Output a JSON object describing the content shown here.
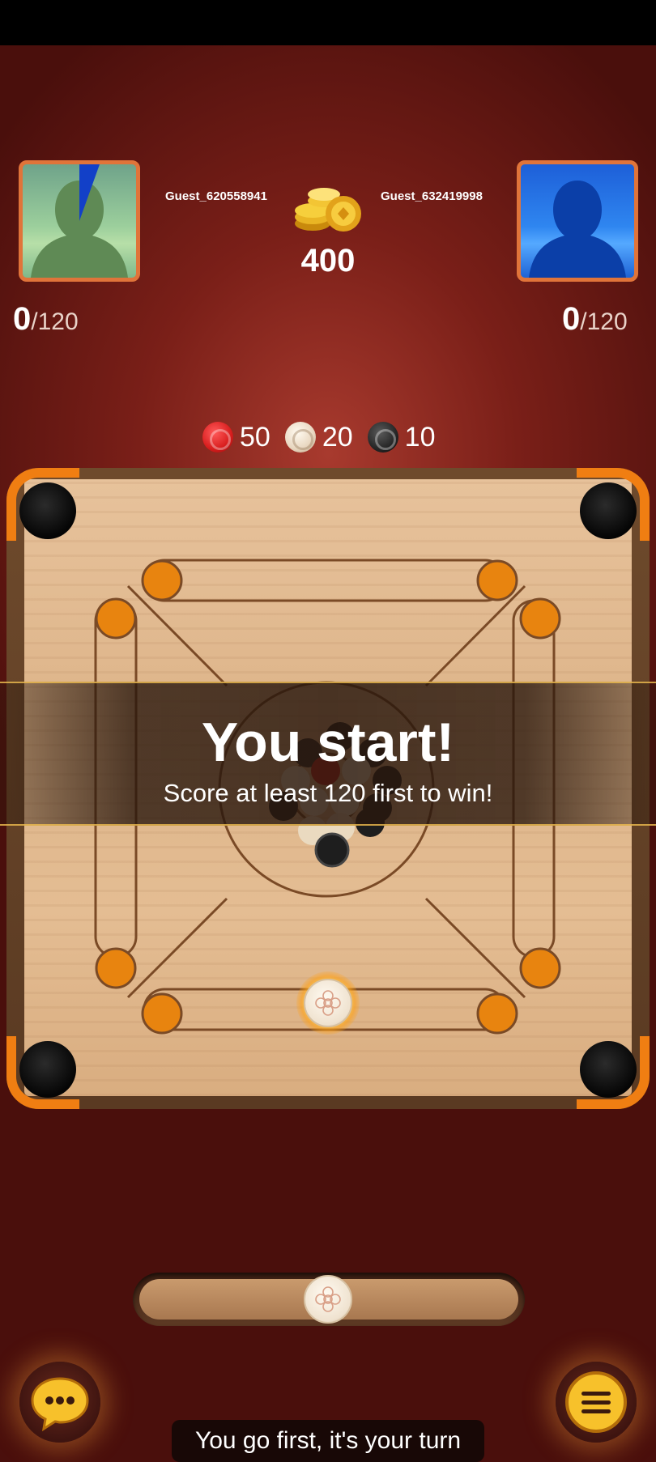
{
  "players": {
    "left": {
      "name": "Guest_620558941",
      "score": "0",
      "max": "/120"
    },
    "right": {
      "name": "Guest_632419998",
      "score": "0",
      "max": "/120"
    }
  },
  "pot": {
    "amount": "400",
    "icon": "gold-coins-icon"
  },
  "coin_values": [
    {
      "color": "red",
      "points": "50"
    },
    {
      "color": "white",
      "points": "20"
    },
    {
      "color": "black",
      "points": "10"
    }
  ],
  "banner": {
    "title": "You start!",
    "subtitle": "Score at least 120 first to win!"
  },
  "toast": "You go first, it's your turn",
  "buttons": {
    "chat_icon": "chat-bubble-icon",
    "menu_icon": "hamburger-menu-icon"
  },
  "colors": {
    "accent": "#f07e12",
    "board": "#e2bb90",
    "background": "#7a1f18"
  }
}
